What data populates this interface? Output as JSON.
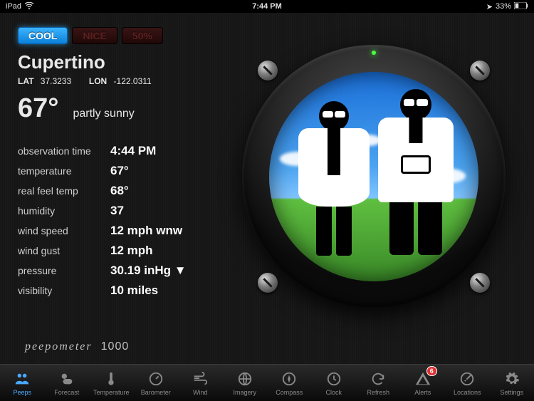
{
  "status": {
    "device": "iPad",
    "time": "7:44 PM",
    "battery": "33%"
  },
  "toggles": [
    {
      "label": "COOL",
      "active": true
    },
    {
      "label": "NICE",
      "active": false
    },
    {
      "label": "50%",
      "active": false
    }
  ],
  "location": {
    "name": "Cupertino",
    "lat_label": "LAT",
    "lat": "37.3233",
    "lon_label": "LON",
    "lon": "-122.0311"
  },
  "current": {
    "temp": "67°",
    "conditions": "partly sunny"
  },
  "rows": [
    {
      "label": "observation time",
      "value": "4:44 PM"
    },
    {
      "label": "temperature",
      "value": "67°"
    },
    {
      "label": "real feel temp",
      "value": "68°"
    },
    {
      "label": "humidity",
      "value": "37"
    },
    {
      "label": "wind speed",
      "value": "12 mph wnw"
    },
    {
      "label": "wind gust",
      "value": "12 mph"
    },
    {
      "label": "pressure",
      "value": "30.19 inHg ▼"
    },
    {
      "label": "visibility",
      "value": "10 miles"
    }
  ],
  "brand": {
    "name": "peepometer",
    "model": "1000"
  },
  "tabs": [
    {
      "label": "Peeps",
      "icon": "peeps-icon",
      "active": true
    },
    {
      "label": "Forecast",
      "icon": "forecast-icon"
    },
    {
      "label": "Temperature",
      "icon": "temperature-icon"
    },
    {
      "label": "Barometer",
      "icon": "barometer-icon"
    },
    {
      "label": "Wind",
      "icon": "wind-icon"
    },
    {
      "label": "Imagery",
      "icon": "imagery-icon"
    },
    {
      "label": "Compass",
      "icon": "compass-icon"
    },
    {
      "label": "Clock",
      "icon": "clock-icon"
    },
    {
      "label": "Refresh",
      "icon": "refresh-icon"
    },
    {
      "label": "Alerts",
      "icon": "alerts-icon",
      "badge": "6"
    },
    {
      "label": "Locations",
      "icon": "locations-icon"
    },
    {
      "label": "Settings",
      "icon": "settings-icon"
    }
  ]
}
